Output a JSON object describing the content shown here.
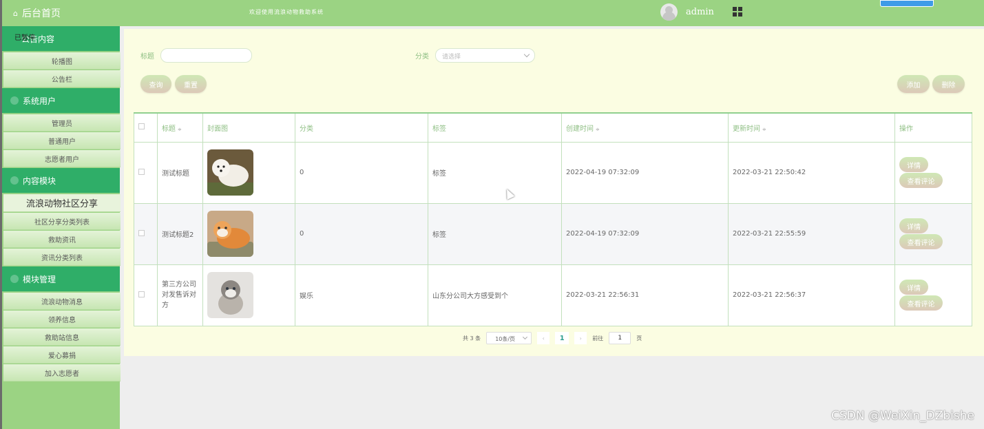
{
  "sidebar": {
    "home": "后台首页",
    "paused_label": "已暂停",
    "groups": [
      {
        "title": "公告内容",
        "items": [
          "轮播图",
          "公告栏"
        ]
      },
      {
        "title": "系统用户",
        "items": [
          "管理员",
          "普通用户",
          "志愿者用户"
        ]
      },
      {
        "title": "内容模块",
        "items": [
          "流浪动物社区分享",
          "社区分享分类列表",
          "救助资讯",
          "资讯分类列表"
        ]
      },
      {
        "title": "模块管理",
        "items": [
          "流浪动物消息",
          "领养信息",
          "救助站信息",
          "爱心募捐",
          "加入志愿者"
        ]
      }
    ]
  },
  "topbar": {
    "welcome": "欢迎使用流浪动物救助系统",
    "username": "admin",
    "icons": [
      "user-avatar-icon",
      "grid-menu-icon"
    ]
  },
  "filters": {
    "title_label": "标题",
    "title_value": "",
    "category_label": "分类",
    "category_placeholder": "请选择",
    "query_button": "查询",
    "reset_button": "重置",
    "add_button": "添加",
    "delete_button": "删除"
  },
  "table": {
    "headers": {
      "title": "标题",
      "cover": "封面图",
      "category": "分类",
      "tag": "标签",
      "created": "创建时间",
      "updated": "更新时间",
      "ops": "操作"
    },
    "sort_glyph": "≑",
    "rows": [
      {
        "title": "测试标题",
        "cover": "white-dog-photo",
        "category": "0",
        "tag": "标签",
        "created": "2022-04-19 07:32:09",
        "updated": "2022-03-21 22:50:42"
      },
      {
        "title": "测试标题2",
        "cover": "orange-cat-photo",
        "category": "0",
        "tag": "标签",
        "created": "2022-04-19 07:32:09",
        "updated": "2022-03-21 22:55:59"
      },
      {
        "title": "第三方公司对发售诉对方",
        "cover": "kitten-photo",
        "category": "娱乐",
        "tag": "山东分公司大方感受到个",
        "created": "2022-03-21 22:56:31",
        "updated": "2022-03-21 22:56:37"
      }
    ],
    "detail_button": "详情",
    "comment_button": "查看评论"
  },
  "pagination": {
    "total": "共 3 条",
    "page_size": "10条/页",
    "prev": "‹",
    "current": "1",
    "next": "›",
    "goto_label": "前往",
    "goto_value": "1",
    "goto_suffix": "页"
  },
  "watermark": "CSDN @WeiXin_DZbishe",
  "colors": {
    "primary": "#9bd383",
    "group": "#2fae68",
    "panel": "#fbfde2",
    "accent": "#8fbf84"
  }
}
